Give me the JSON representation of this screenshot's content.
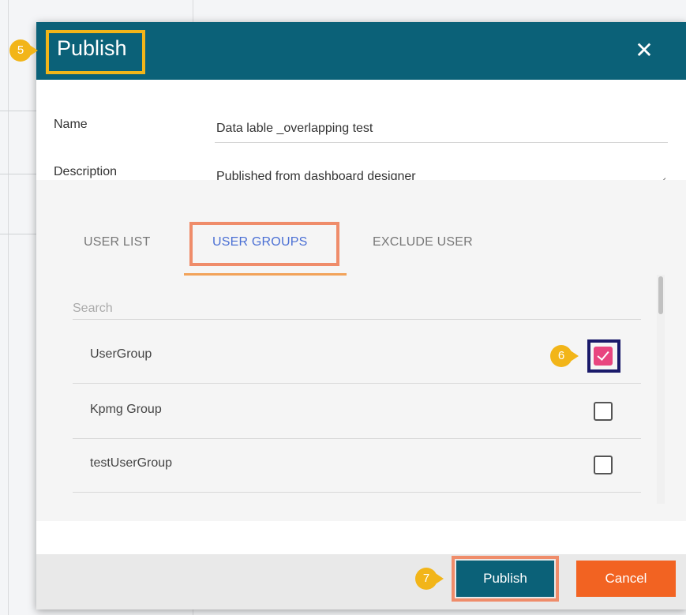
{
  "dialog": {
    "title": "Publish",
    "close_glyph": "✕"
  },
  "form": {
    "name_label": "Name",
    "name_value": "Data lable _overlapping test",
    "description_label": "Description",
    "description_value": "Published from dashboard designer"
  },
  "tabs": [
    {
      "label": "USER LIST",
      "active": false
    },
    {
      "label": "USER GROUPS",
      "active": true
    },
    {
      "label": "EXCLUDE USER",
      "active": false
    }
  ],
  "search": {
    "placeholder": "Search"
  },
  "groups": [
    {
      "label": "UserGroup",
      "checked": true
    },
    {
      "label": "Kpmg Group",
      "checked": false
    },
    {
      "label": "testUserGroup",
      "checked": false
    }
  ],
  "footer": {
    "publish_label": "Publish",
    "cancel_label": "Cancel"
  },
  "steps": {
    "title_step": "5",
    "checkbox_step": "6",
    "publish_step": "7"
  },
  "colors": {
    "header": "#0b6178",
    "callout": "#f2b519",
    "highlight": "#ef8c6a",
    "cancel": "#f26322",
    "checked": "#e8457f",
    "active_tab": "#4a6fd4"
  }
}
